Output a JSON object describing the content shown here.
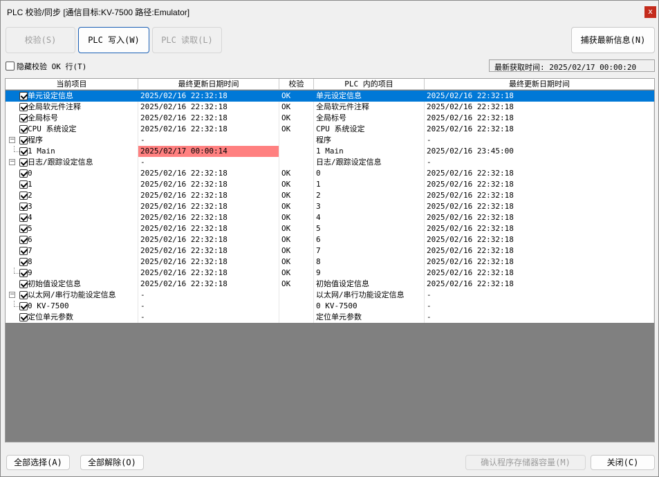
{
  "window": {
    "title": "PLC 校验/同步 [通信目标:KV-7500 路径:Emulator]",
    "close_glyph": "x",
    "close_color": "#c42b1c"
  },
  "toolbar": {
    "verify_label": "校验(S)",
    "plc_write_label": "PLC 写入(W)",
    "plc_read_label": "PLC 读取(L)",
    "capture_label": "捕获最新信息(N)"
  },
  "options": {
    "hide_ok_label": "隐藏校验 OK 行(T)",
    "fetch_time_label": "最新获取时间: 2025/02/17 00:00:20"
  },
  "table": {
    "headers": [
      "当前项目",
      "最终更新日期时间",
      "校验",
      "PLC 内的项目",
      "最终更新日期时间"
    ],
    "rows": [
      {
        "item": "单元设定信息",
        "date": "2025/02/16 22:32:18",
        "verify": "OK",
        "plc_item": "单元设定信息",
        "plc_date": "2025/02/16 22:32:18"
      },
      {
        "item": "全局软元件注释",
        "date": "2025/02/16 22:32:18",
        "verify": "OK",
        "plc_item": "全局软元件注释",
        "plc_date": "2025/02/16 22:32:18"
      },
      {
        "item": "全局标号",
        "date": "2025/02/16 22:32:18",
        "verify": "OK",
        "plc_item": "全局标号",
        "plc_date": "2025/02/16 22:32:18"
      },
      {
        "item": "CPU 系统设定",
        "date": "2025/02/16 22:32:18",
        "verify": "OK",
        "plc_item": "CPU 系统设定",
        "plc_date": "2025/02/16 22:32:18"
      },
      {
        "item": "程序",
        "date": "-",
        "verify": "",
        "plc_item": "程序",
        "plc_date": "-"
      },
      {
        "item": "1    Main",
        "date": "2025/02/17 00:00:14",
        "verify": "",
        "plc_item": "1    Main",
        "plc_date": "2025/02/16 23:45:00"
      },
      {
        "item": "日志/跟踪设定信息",
        "date": "-",
        "verify": "",
        "plc_item": "日志/跟踪设定信息",
        "plc_date": "-"
      },
      {
        "item": "0",
        "date": "2025/02/16 22:32:18",
        "verify": "OK",
        "plc_item": "0",
        "plc_date": "2025/02/16 22:32:18"
      },
      {
        "item": "1",
        "date": "2025/02/16 22:32:18",
        "verify": "OK",
        "plc_item": "1",
        "plc_date": "2025/02/16 22:32:18"
      },
      {
        "item": "2",
        "date": "2025/02/16 22:32:18",
        "verify": "OK",
        "plc_item": "2",
        "plc_date": "2025/02/16 22:32:18"
      },
      {
        "item": "3",
        "date": "2025/02/16 22:32:18",
        "verify": "OK",
        "plc_item": "3",
        "plc_date": "2025/02/16 22:32:18"
      },
      {
        "item": "4",
        "date": "2025/02/16 22:32:18",
        "verify": "OK",
        "plc_item": "4",
        "plc_date": "2025/02/16 22:32:18"
      },
      {
        "item": "5",
        "date": "2025/02/16 22:32:18",
        "verify": "OK",
        "plc_item": "5",
        "plc_date": "2025/02/16 22:32:18"
      },
      {
        "item": "6",
        "date": "2025/02/16 22:32:18",
        "verify": "OK",
        "plc_item": "6",
        "plc_date": "2025/02/16 22:32:18"
      },
      {
        "item": "7",
        "date": "2025/02/16 22:32:18",
        "verify": "OK",
        "plc_item": "7",
        "plc_date": "2025/02/16 22:32:18"
      },
      {
        "item": "8",
        "date": "2025/02/16 22:32:18",
        "verify": "OK",
        "plc_item": "8",
        "plc_date": "2025/02/16 22:32:18"
      },
      {
        "item": "9",
        "date": "2025/02/16 22:32:18",
        "verify": "OK",
        "plc_item": "9",
        "plc_date": "2025/02/16 22:32:18"
      },
      {
        "item": "初始值设定信息",
        "date": "2025/02/16 22:32:18",
        "verify": "OK",
        "plc_item": "初始值设定信息",
        "plc_date": "2025/02/16 22:32:18"
      },
      {
        "item": "以太网/串行功能设定信息",
        "date": "-",
        "verify": "",
        "plc_item": "以太网/串行功能设定信息",
        "plc_date": "-"
      },
      {
        "item": "0    KV-7500",
        "date": "-",
        "verify": "",
        "plc_item": "0    KV-7500",
        "plc_date": "-"
      },
      {
        "item": "定位单元参数",
        "date": "-",
        "verify": "",
        "plc_item": "定位单元参数",
        "plc_date": "-"
      }
    ],
    "selected_color": "#0078d7",
    "mismatch_color": "#ff8080"
  },
  "footer": {
    "select_all_label": "全部选择(A)",
    "deselect_all_label": "全部解除(O)",
    "check_memory_label": "确认程序存储器容量(M)",
    "close_label": "关闭(C)"
  }
}
